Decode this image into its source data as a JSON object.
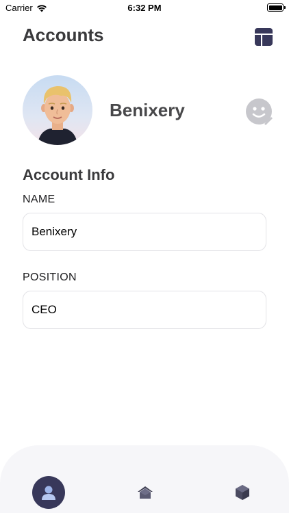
{
  "status_bar": {
    "carrier": "Carrier",
    "time": "6:32 PM",
    "battery_level": 1.0
  },
  "header": {
    "title": "Accounts",
    "action_icon": "layout-icon"
  },
  "profile": {
    "name": "Benixery",
    "avatar_icon": "memoji-avatar",
    "edit_icon": "edit-sticker-icon"
  },
  "account_info": {
    "section_title": "Account Info",
    "name_label": "NAME",
    "name_value": "Benixery",
    "position_label": "POSITION",
    "position_value": "CEO"
  },
  "tab_bar": {
    "tabs": [
      {
        "icon": "person-icon",
        "selected": true
      },
      {
        "icon": "home-icon",
        "selected": false
      },
      {
        "icon": "hexagon-icon",
        "selected": false
      }
    ]
  },
  "colors": {
    "accent": "#38385a",
    "text_primary": "#3a3a3c",
    "icon_gray": "#c7c7cc"
  }
}
